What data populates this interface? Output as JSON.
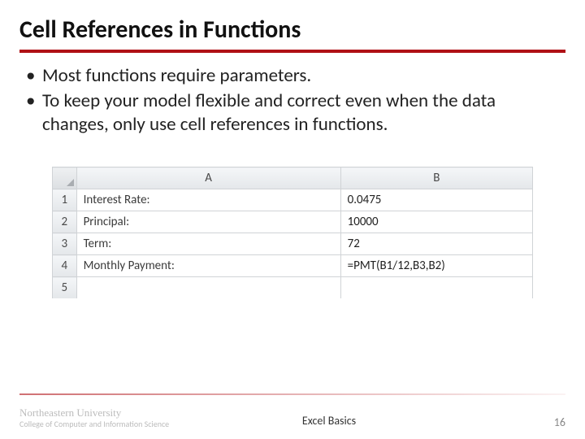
{
  "title": "Cell References in Functions",
  "bullets": [
    "Most functions require parameters.",
    "To keep your model flexible and correct even when the data changes, only use cell references in functions."
  ],
  "excel": {
    "columns": [
      "A",
      "B"
    ],
    "rows": [
      {
        "num": "1",
        "a": "Interest Rate:",
        "b": "0.0475"
      },
      {
        "num": "2",
        "a": "Principal:",
        "b": "10000"
      },
      {
        "num": "3",
        "a": "Term:",
        "b": "72"
      },
      {
        "num": "4",
        "a": "Monthly Payment:",
        "b": "=PMT(B1/12,B3,B2)"
      }
    ],
    "partial_row_num": "5"
  },
  "footer": {
    "university_name": "Northeastern University",
    "university_sub": "College of Computer and Information Science",
    "center": "Excel Basics",
    "page": "16"
  }
}
